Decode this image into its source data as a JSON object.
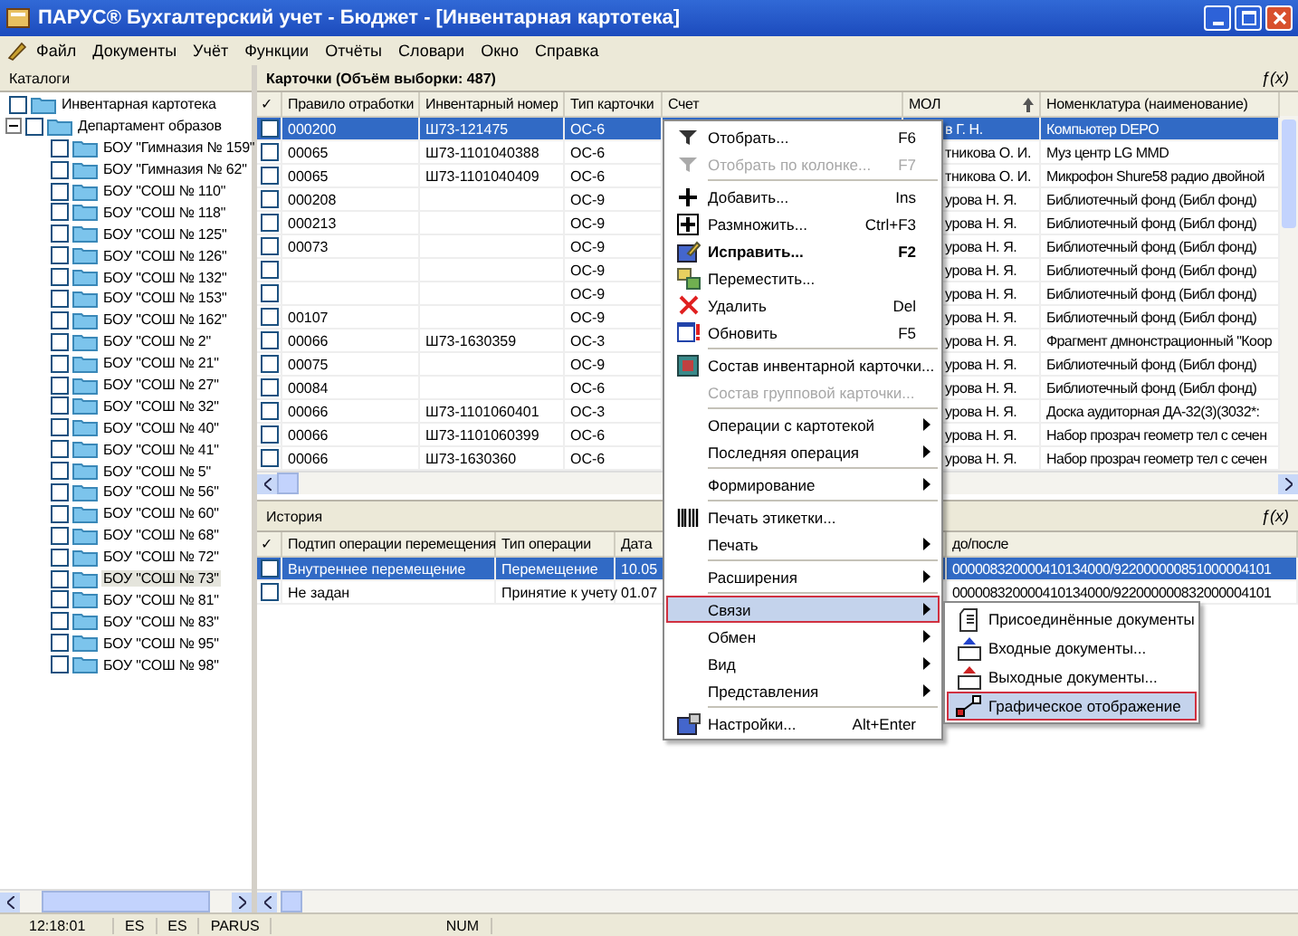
{
  "window": {
    "title": "ПАРУС® Бухгалтерский учет - Бюджет - [Инвентарная картотека]"
  },
  "menu_bar": [
    "Файл",
    "Документы",
    "Учёт",
    "Функции",
    "Отчёты",
    "Словари",
    "Окно",
    "Справка"
  ],
  "catalog_panel": {
    "title": "Каталоги",
    "tree": [
      {
        "label": "Инвентарная картотека",
        "checked": false,
        "selected": false
      },
      {
        "label": "Департамент образов",
        "checked": false,
        "selected": false,
        "expanded": true,
        "children": [
          {
            "label": "БОУ \"Гимназия № 159\"",
            "checked": false,
            "selected": false
          },
          {
            "label": "БОУ \"Гимназия № 62\"",
            "checked": false,
            "selected": false
          },
          {
            "label": "БОУ \"СОШ № 110\"",
            "checked": false,
            "selected": false
          },
          {
            "label": "БОУ \"СОШ № 118\"",
            "checked": false,
            "selected": false
          },
          {
            "label": "БОУ \"СОШ № 125\"",
            "checked": false,
            "selected": false
          },
          {
            "label": "БОУ \"СОШ № 126\"",
            "checked": false,
            "selected": false
          },
          {
            "label": "БОУ \"СОШ № 132\"",
            "checked": false,
            "selected": false
          },
          {
            "label": "БОУ \"СОШ № 153\"",
            "checked": false,
            "selected": false
          },
          {
            "label": "БОУ \"СОШ № 162\"",
            "checked": false,
            "selected": false
          },
          {
            "label": "БОУ \"СОШ № 2\"",
            "checked": false,
            "selected": false
          },
          {
            "label": "БОУ \"СОШ № 21\"",
            "checked": false,
            "selected": false
          },
          {
            "label": "БОУ \"СОШ № 27\"",
            "checked": false,
            "selected": false
          },
          {
            "label": "БОУ \"СОШ № 32\"",
            "checked": false,
            "selected": false
          },
          {
            "label": "БОУ \"СОШ № 40\"",
            "checked": false,
            "selected": false
          },
          {
            "label": "БОУ \"СОШ № 41\"",
            "checked": false,
            "selected": false
          },
          {
            "label": "БОУ \"СОШ № 5\"",
            "checked": false,
            "selected": false
          },
          {
            "label": "БОУ \"СОШ № 56\"",
            "checked": false,
            "selected": false
          },
          {
            "label": "БОУ \"СОШ № 60\"",
            "checked": false,
            "selected": false
          },
          {
            "label": "БОУ \"СОШ № 68\"",
            "checked": false,
            "selected": false
          },
          {
            "label": "БОУ \"СОШ № 72\"",
            "checked": false,
            "selected": false
          },
          {
            "label": "БОУ \"СОШ № 73\"",
            "checked": false,
            "selected": true
          },
          {
            "label": "БОУ \"СОШ № 81\"",
            "checked": false,
            "selected": false
          },
          {
            "label": "БОУ \"СОШ № 83\"",
            "checked": false,
            "selected": false
          },
          {
            "label": "БОУ \"СОШ № 95\"",
            "checked": false,
            "selected": false
          },
          {
            "label": "БОУ \"СОШ № 98\"",
            "checked": false,
            "selected": false
          }
        ]
      }
    ]
  },
  "cards_panel": {
    "title": "Карточки (Объём выборки: 487)",
    "formula_button": "ƒ(x)",
    "check_column": "✓",
    "columns": [
      {
        "label": "Правило отработки"
      },
      {
        "label": "Инвентарный номер"
      },
      {
        "label": "Тип карточки"
      },
      {
        "label": "Счет"
      },
      {
        "label": "МОЛ",
        "sort_ascending": true
      },
      {
        "label": "Номенклатура (наименование)"
      }
    ],
    "rows": [
      {
        "checked": false,
        "selected": true,
        "rule": "000200",
        "inventory_number": "Ш73-121475",
        "card_type": "ОС-6",
        "mol": "в Г. Н.",
        "nomenclature": "Компьютер DEPO"
      },
      {
        "checked": false,
        "selected": false,
        "rule": "00065",
        "inventory_number": "Ш73-1101040388",
        "card_type": "ОС-6",
        "mol": "тникова О. И.",
        "nomenclature": "Муз центр LG MMD"
      },
      {
        "checked": false,
        "selected": false,
        "rule": "00065",
        "inventory_number": "Ш73-1101040409",
        "card_type": "ОС-6",
        "mol": "тникова О. И.",
        "nomenclature": "Микрофон Shure58 радио двойной"
      },
      {
        "checked": false,
        "selected": false,
        "rule": "000208",
        "card_type": "ОС-9",
        "mol": "урова Н. Я.",
        "nomenclature": "Библиотечный фонд (Библ фонд)"
      },
      {
        "checked": false,
        "selected": false,
        "rule": "000213",
        "card_type": "ОС-9",
        "mol": "урова Н. Я.",
        "nomenclature": "Библиотечный фонд (Библ фонд)"
      },
      {
        "checked": false,
        "selected": false,
        "rule": "00073",
        "card_type": "ОС-9",
        "mol": "урова Н. Я.",
        "nomenclature": "Библиотечный фонд (Библ фонд)"
      },
      {
        "checked": false,
        "selected": false,
        "card_type": "ОС-9",
        "mol": "урова Н. Я.",
        "nomenclature": "Библиотечный фонд (Библ фонд)"
      },
      {
        "checked": false,
        "selected": false,
        "card_type": "ОС-9",
        "mol": "урова Н. Я.",
        "nomenclature": "Библиотечный фонд (Библ фонд)"
      },
      {
        "checked": false,
        "selected": false,
        "rule": "00107",
        "card_type": "ОС-9",
        "mol": "урова Н. Я.",
        "nomenclature": "Библиотечный фонд (Библ фонд)"
      },
      {
        "checked": false,
        "selected": false,
        "rule": "00066",
        "inventory_number": "Ш73-1630359",
        "card_type": "ОС-3",
        "mol": "урова Н. Я.",
        "nomenclature": "Фрагмент дмнонстрационный \"Коор"
      },
      {
        "checked": false,
        "selected": false,
        "rule": "00075",
        "card_type": "ОС-9",
        "mol": "урова Н. Я.",
        "nomenclature": "Библиотечный фонд (Библ фонд)"
      },
      {
        "checked": false,
        "selected": false,
        "rule": "00084",
        "card_type": "ОС-6",
        "mol": "урова Н. Я.",
        "nomenclature": "Библиотечный фонд (Библ фонд)"
      },
      {
        "checked": false,
        "selected": false,
        "rule": "00066",
        "inventory_number": "Ш73-1101060401",
        "card_type": "ОС-3",
        "mol": "урова Н. Я.",
        "nomenclature": "Доска аудиторная ДА-32(3)(3032*:"
      },
      {
        "checked": false,
        "selected": false,
        "rule": "00066",
        "inventory_number": "Ш73-1101060399",
        "card_type": "ОС-6",
        "mol": "урова Н. Я.",
        "nomenclature": "Набор прозрач геометр тел с сечен"
      },
      {
        "checked": false,
        "selected": false,
        "rule": "00066",
        "inventory_number": "Ш73-1630360",
        "card_type": "ОС-6",
        "mol": "урова Н. Я.",
        "nomenclature": "Набор прозрач геометр тел с сечен"
      }
    ]
  },
  "history_panel": {
    "title": "История",
    "formula_button": "ƒ(x)",
    "check_column": "✓",
    "columns": [
      {
        "label": "Подтип операции перемещения"
      },
      {
        "label": "Тип операции"
      },
      {
        "label": "Дата"
      },
      {
        "label": "до/после"
      }
    ],
    "rows": [
      {
        "checked": false,
        "selected": true,
        "subtype": "Внутреннее перемещение",
        "operation_type": "Перемещение",
        "date": "10.05",
        "column_4": "000008320000410134000/922000000851000004101"
      },
      {
        "checked": false,
        "selected": false,
        "subtype": "Не задан",
        "operation_type": "Принятие к учету",
        "date": "01.07",
        "column_4": "000008320000410134000/922000000832000004101"
      }
    ]
  },
  "context_menu": {
    "groups": [
      [
        {
          "label": "Отобрать...",
          "shortcut": "F6",
          "disabled": false,
          "selected": false
        },
        {
          "label": "Отобрать по колонке...",
          "shortcut": "F7",
          "disabled": true,
          "selected": false
        }
      ],
      [
        {
          "label": "Добавить...",
          "shortcut": "Ins",
          "disabled": false,
          "selected": false
        },
        {
          "label": "Размножить...",
          "shortcut": "Ctrl+F3",
          "disabled": false,
          "selected": false
        },
        {
          "label": "Исправить...",
          "shortcut": "F2",
          "disabled": false,
          "selected": false,
          "default": true
        },
        {
          "label": "Переместить...",
          "disabled": false,
          "selected": false
        },
        {
          "label": "Удалить",
          "shortcut": "Del",
          "disabled": false,
          "selected": false
        },
        {
          "label": "Обновить",
          "shortcut": "F5",
          "disabled": false,
          "selected": false
        }
      ],
      [
        {
          "label": "Состав инвентарной карточки...",
          "disabled": false,
          "selected": false
        },
        {
          "label": "Состав групповой карточки...",
          "disabled": true,
          "selected": false
        }
      ],
      [
        {
          "label": "Операции с картотекой",
          "submenu": true,
          "disabled": false,
          "selected": false
        },
        {
          "label": "Последняя операция",
          "submenu": true,
          "disabled": false,
          "selected": false
        }
      ],
      [
        {
          "label": "Формирование",
          "submenu": true,
          "disabled": false,
          "selected": false
        }
      ],
      [
        {
          "label": "Печать этикетки...",
          "disabled": false,
          "selected": false
        },
        {
          "label": "Печать",
          "submenu": true,
          "disabled": false,
          "selected": false
        }
      ],
      [
        {
          "label": "Расширения",
          "submenu": true,
          "disabled": false,
          "selected": false
        }
      ],
      [
        {
          "label": "Связи",
          "submenu": true,
          "disabled": false,
          "selected": true
        },
        {
          "label": "Обмен",
          "submenu": true,
          "disabled": false,
          "selected": false
        },
        {
          "label": "Вид",
          "submenu": true,
          "disabled": false,
          "selected": false
        },
        {
          "label": "Представления",
          "submenu": true,
          "disabled": false,
          "selected": false
        }
      ],
      [
        {
          "label": "Настройки...",
          "shortcut": "Alt+Enter",
          "disabled": false,
          "selected": false
        }
      ]
    ]
  },
  "submenu": {
    "items": [
      {
        "label": "Присоединённые документы",
        "selected": false
      },
      {
        "label": "Входные документы...",
        "selected": false
      },
      {
        "label": "Выходные документы...",
        "selected": false
      },
      {
        "label": "Графическое отображение",
        "selected": true
      }
    ]
  },
  "status_bar": [
    "12:18:01",
    "ES",
    "ES",
    "PARUS",
    "NUM"
  ]
}
